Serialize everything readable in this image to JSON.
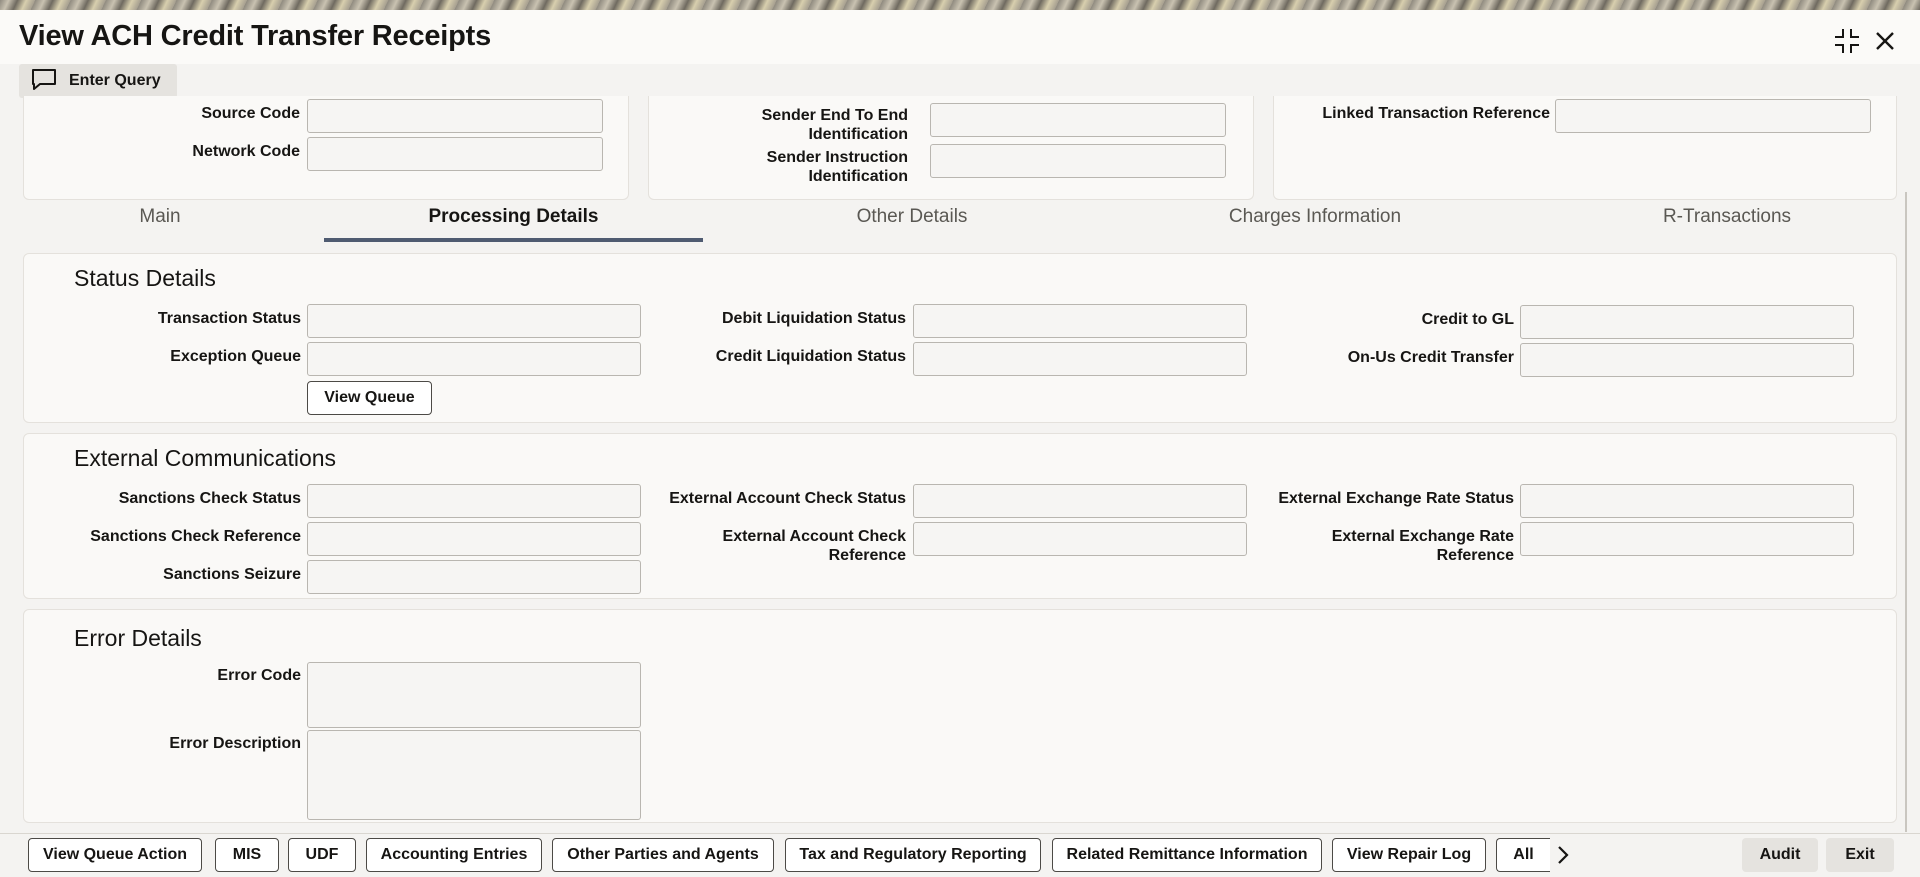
{
  "window": {
    "title": "View ACH Credit Transfer Receipts",
    "enter_query_label": "Enter Query"
  },
  "header_fields": {
    "source_code": {
      "label": "Source Code",
      "value": ""
    },
    "network_code": {
      "label": "Network Code",
      "value": ""
    },
    "sender_e2e_line1": "Sender End To End",
    "sender_e2e_line2": "Identification",
    "sender_e2e_value": "",
    "sender_instr_line1": "Sender Instruction",
    "sender_instr_line2": "Identification",
    "sender_instr_value": "",
    "linked_txn": {
      "label": "Linked Transaction Reference",
      "value": ""
    }
  },
  "tabs": [
    {
      "label": "Main",
      "active": false
    },
    {
      "label": "Processing Details",
      "active": true
    },
    {
      "label": "Other Details",
      "active": false
    },
    {
      "label": "Charges Information",
      "active": false
    },
    {
      "label": "R-Transactions",
      "active": false
    }
  ],
  "status_details": {
    "title": "Status Details",
    "transaction_status": {
      "label": "Transaction Status",
      "value": ""
    },
    "exception_queue": {
      "label": "Exception Queue",
      "value": ""
    },
    "view_queue_label": "View Queue",
    "debit_liquidation_status": {
      "label": "Debit Liquidation Status",
      "value": ""
    },
    "credit_liquidation_status": {
      "label": "Credit Liquidation Status",
      "value": ""
    },
    "credit_to_gl": {
      "label": "Credit to GL",
      "value": ""
    },
    "onus_credit_transfer": {
      "label": "On-Us Credit Transfer",
      "value": ""
    }
  },
  "external_communications": {
    "title": "External Communications",
    "sanctions_check_status": {
      "label": "Sanctions Check Status",
      "value": ""
    },
    "sanctions_check_reference": {
      "label": "Sanctions Check Reference",
      "value": ""
    },
    "sanctions_seizure": {
      "label": "Sanctions Seizure",
      "value": ""
    },
    "ext_account_check_status": {
      "label": "External Account Check Status",
      "value": ""
    },
    "ext_account_check_ref_line1": "External Account Check",
    "ext_account_check_ref_line2": "Reference",
    "ext_account_check_ref_value": "",
    "ext_exchange_rate_status": {
      "label": "External Exchange Rate Status",
      "value": ""
    },
    "ext_exchange_rate_ref_line1": "External Exchange Rate",
    "ext_exchange_rate_ref_line2": "Reference",
    "ext_exchange_rate_ref_value": ""
  },
  "error_details": {
    "title": "Error Details",
    "error_code": {
      "label": "Error Code",
      "value": ""
    },
    "error_description": {
      "label": "Error Description",
      "value": ""
    }
  },
  "footer": {
    "buttons": [
      "View Queue Action",
      "MIS",
      "UDF",
      "Accounting Entries",
      "Other Parties and Agents",
      "Tax and Regulatory Reporting",
      "Related Remittance Information",
      "View Repair Log",
      "All"
    ],
    "audit_label": "Audit",
    "exit_label": "Exit"
  },
  "icons": {
    "collapse": "collapse-icon",
    "close": "close-icon",
    "enter_query": "chat-bubble-icon",
    "more": "chevron-right-icon"
  }
}
